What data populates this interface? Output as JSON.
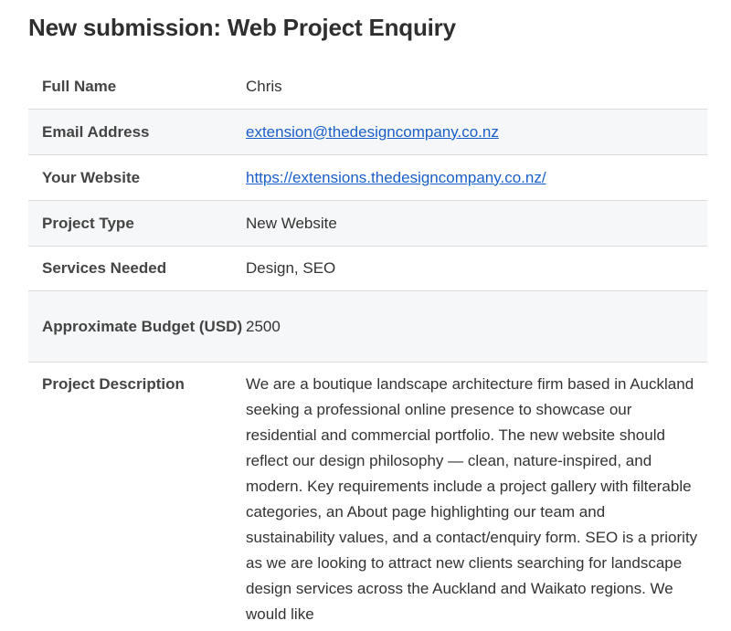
{
  "page": {
    "title": "New submission: Web Project Enquiry"
  },
  "fields": {
    "full_name": {
      "label": "Full Name",
      "value": "Chris"
    },
    "email": {
      "label": "Email Address",
      "value": "extension@thedesigncompany.co.nz"
    },
    "website": {
      "label": "Your Website",
      "value": "https://extensions.thedesigncompany.co.nz/"
    },
    "project_type": {
      "label": "Project Type",
      "value": "New Website"
    },
    "services": {
      "label": "Services Needed",
      "value": "Design, SEO"
    },
    "budget": {
      "label": "Approximate Budget (USD)",
      "value": "2500"
    },
    "description": {
      "label": "Project Description",
      "value": "We are a boutique landscape architecture firm based in Auckland seeking a professional online presence to showcase our residential and commercial portfolio. The new website should reflect our design philosophy — clean, nature-inspired, and modern. Key requirements include a project gallery with filterable categories, an About page highlighting our team and sustainability values, and a contact/enquiry form. SEO is a priority as we are looking to attract new clients searching for landscape design services across the Auckland and Waikato regions. We would like"
    }
  },
  "colors": {
    "link": "#1a5fc9",
    "row_shade": "#f6f7f8",
    "divider": "#dcdcdc"
  }
}
